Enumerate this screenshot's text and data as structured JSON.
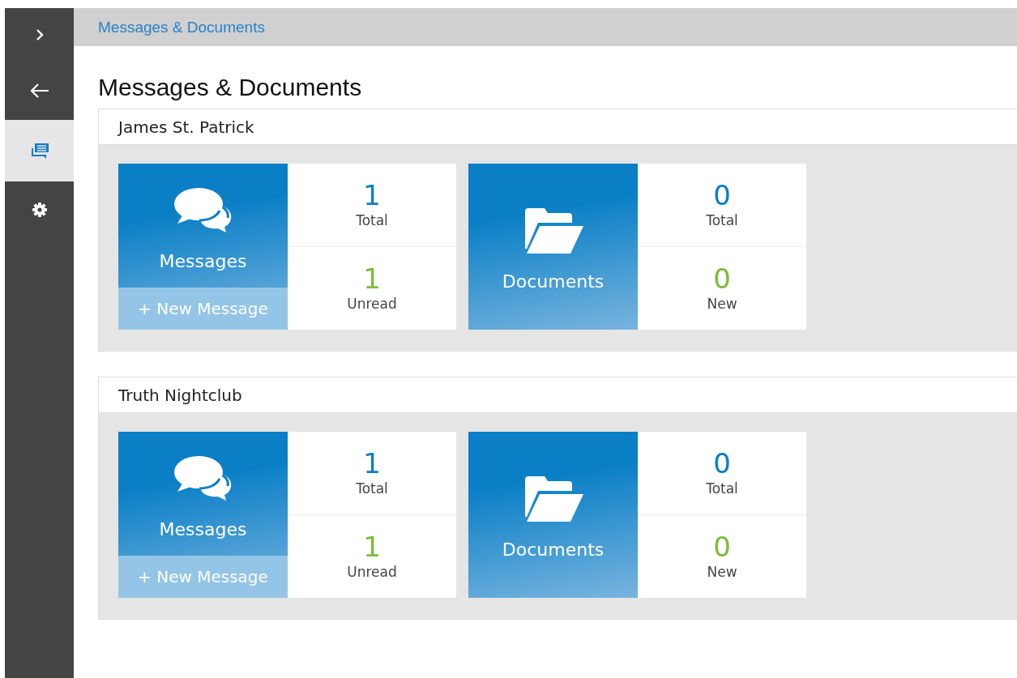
{
  "sidebar": {
    "items": [
      {
        "kind": "expand",
        "selected": false
      },
      {
        "kind": "back",
        "selected": false
      },
      {
        "kind": "messages",
        "selected": true
      },
      {
        "kind": "settings",
        "selected": false
      }
    ]
  },
  "breadcrumb": "Messages & Documents",
  "page_title": "Messages & Documents",
  "groups": [
    {
      "name": "James St. Patrick",
      "tiles": [
        {
          "kind": "messages",
          "label": "Messages",
          "action": "+ New Message",
          "stats": [
            {
              "value": "1",
              "label": "Total",
              "color": "#0a7fc6"
            },
            {
              "value": "1",
              "label": "Unread",
              "color": "#7dbb3a"
            }
          ]
        },
        {
          "kind": "documents",
          "label": "Documents",
          "stats": [
            {
              "value": "0",
              "label": "Total",
              "color": "#0a7fc6"
            },
            {
              "value": "0",
              "label": "New",
              "color": "#7dbb3a"
            }
          ]
        }
      ]
    },
    {
      "name": "Truth Nightclub",
      "tiles": [
        {
          "kind": "messages",
          "label": "Messages",
          "action": "+ New Message",
          "stats": [
            {
              "value": "1",
              "label": "Total",
              "color": "#0a7fc6"
            },
            {
              "value": "1",
              "label": "Unread",
              "color": "#7dbb3a"
            }
          ]
        },
        {
          "kind": "documents",
          "label": "Documents",
          "stats": [
            {
              "value": "0",
              "label": "Total",
              "color": "#0a7fc6"
            },
            {
              "value": "0",
              "label": "New",
              "color": "#7dbb3a"
            }
          ]
        }
      ]
    }
  ]
}
